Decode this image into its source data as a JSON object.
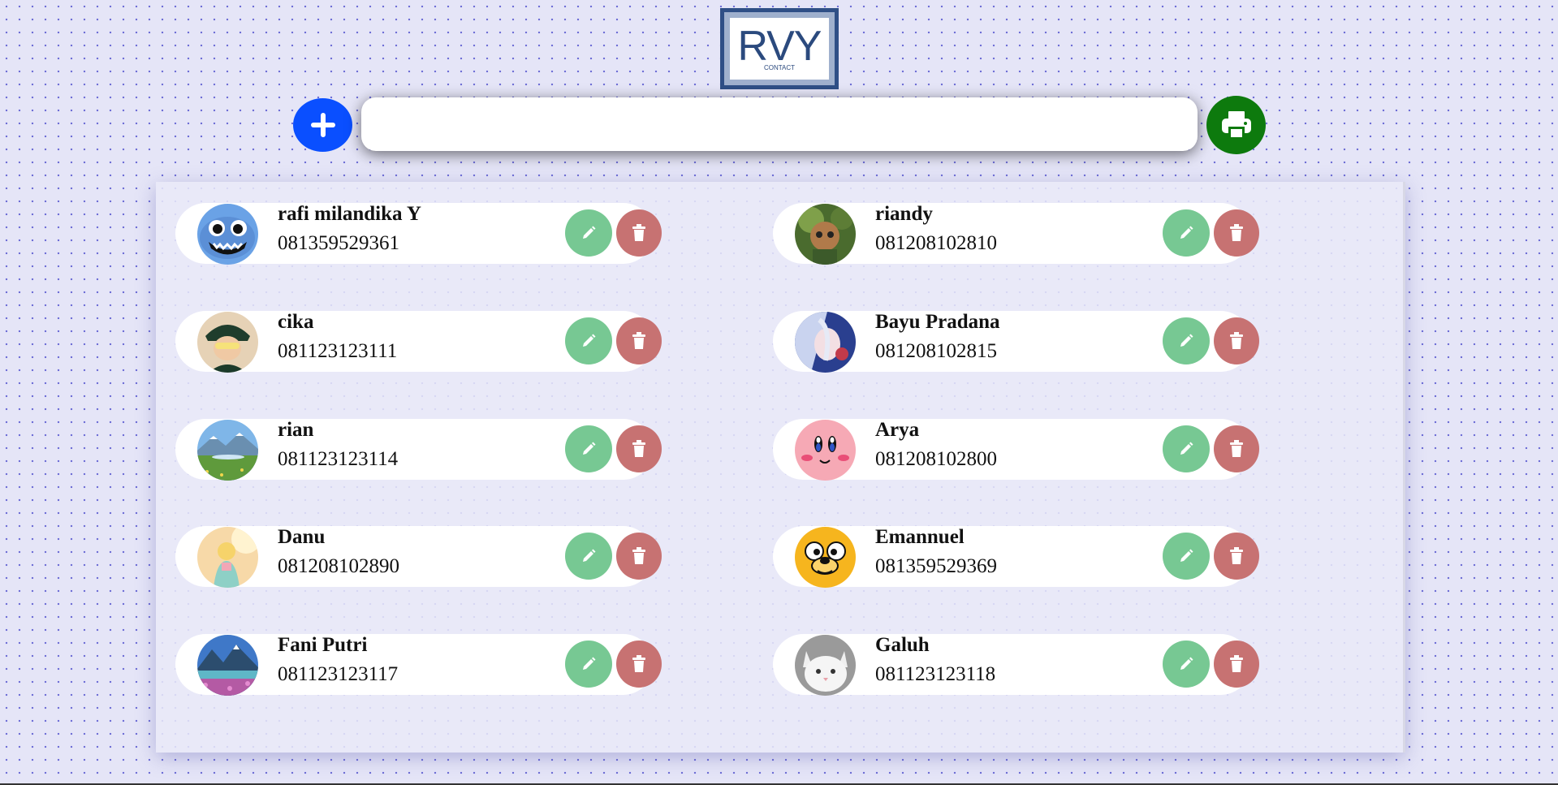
{
  "logo": {
    "text": "RVY",
    "subtext": "CONTACT"
  },
  "toolbar": {
    "add_icon": "plus-icon",
    "search": {
      "value": "",
      "placeholder": ""
    },
    "print_icon": "printer-icon"
  },
  "colors": {
    "add_button": "#0a4fff",
    "print_button": "#0d7a0d",
    "edit_button": "#77c893",
    "delete_button": "#c77272",
    "background": "#e5e5f7"
  },
  "contacts": [
    {
      "name": "rafi milandika Y",
      "phone": "081359529361",
      "avatar": "stitch-avatar"
    },
    {
      "name": "riandy",
      "phone": "081208102810",
      "avatar": "photo-avatar"
    },
    {
      "name": "cika",
      "phone": "081123123111",
      "avatar": "photo-avatar"
    },
    {
      "name": "Bayu Pradana",
      "phone": "081208102815",
      "avatar": "anime-avatar"
    },
    {
      "name": "rian",
      "phone": "081123123114",
      "avatar": "landscape-avatar"
    },
    {
      "name": "Arya",
      "phone": "081208102800",
      "avatar": "kirby-avatar"
    },
    {
      "name": "Danu",
      "phone": "081208102890",
      "avatar": "photo-avatar"
    },
    {
      "name": "Emannuel",
      "phone": "081359529369",
      "avatar": "jake-avatar"
    },
    {
      "name": "Fani Putri",
      "phone": "081123123117",
      "avatar": "landscape-avatar"
    },
    {
      "name": "Galuh",
      "phone": "081123123118",
      "avatar": "cat-avatar"
    }
  ]
}
